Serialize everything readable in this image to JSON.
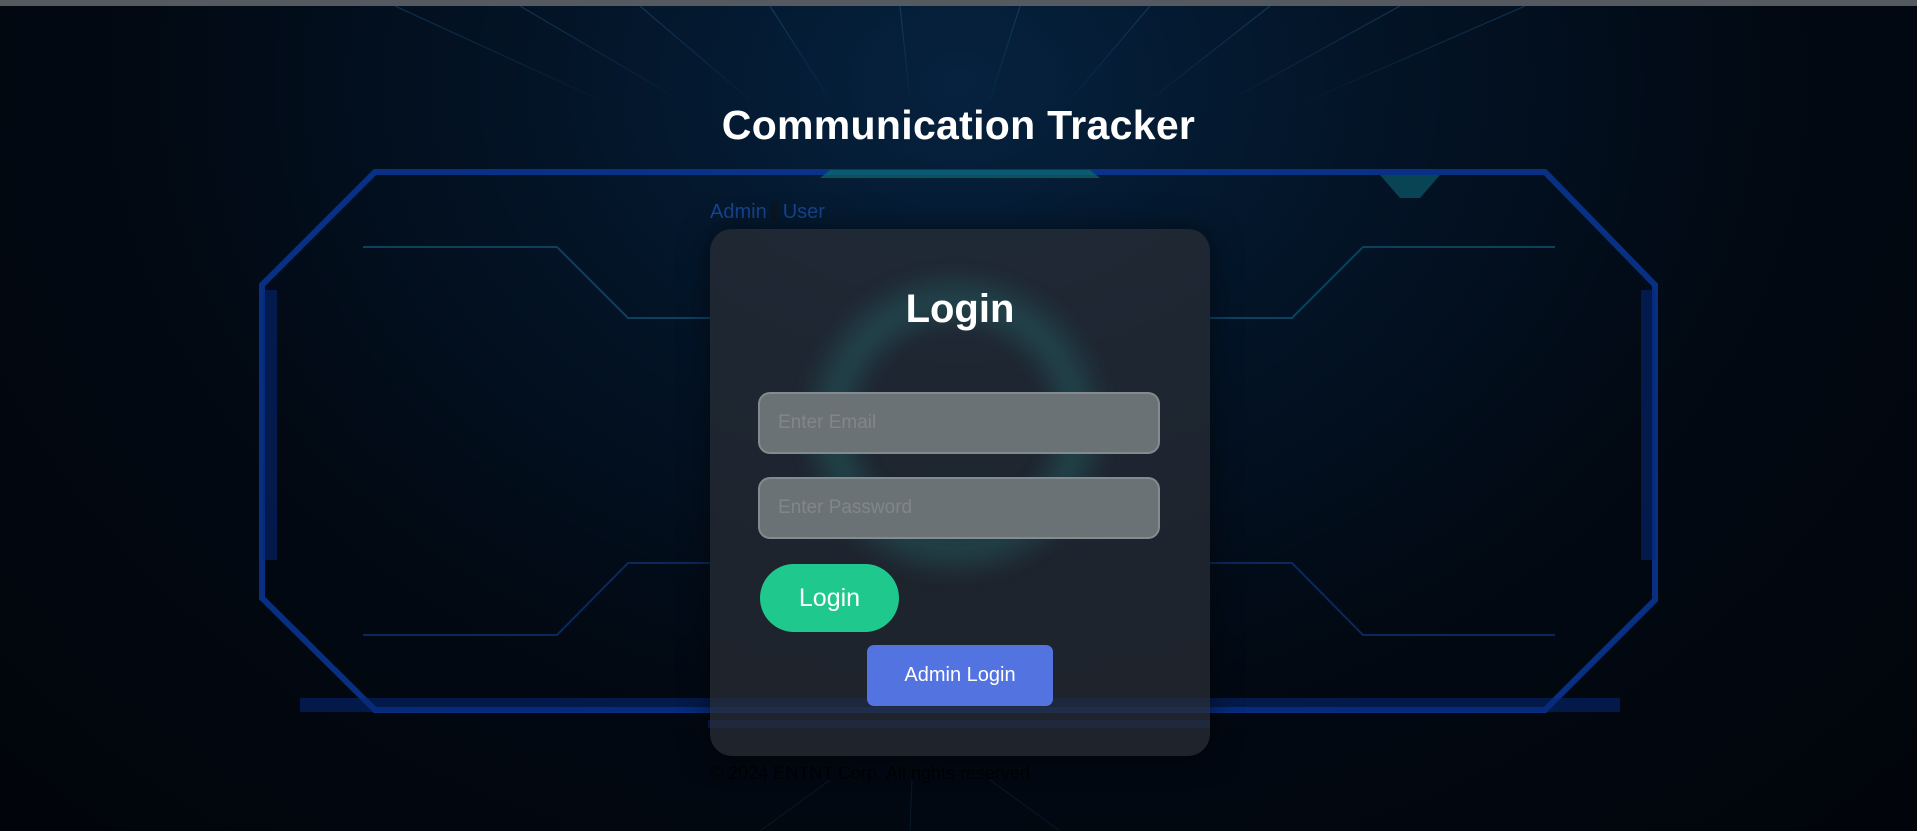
{
  "app": {
    "title": "Communication Tracker"
  },
  "role_tabs": [
    {
      "label": "Admin"
    },
    {
      "label": "User"
    }
  ],
  "login_card": {
    "title": "Login",
    "email_placeholder": "Enter Email",
    "password_placeholder": "Enter Password",
    "login_button": "Login",
    "admin_login_button": "Admin Login"
  },
  "footer": {
    "text": "© 2024 ENTNT Corp. All rights reserved."
  },
  "colors": {
    "background": "#02060d",
    "accent_blue": "#0a3a9e",
    "accent_teal": "#0e5a5a",
    "login_button": "#1fc98e",
    "admin_button": "#5273e0",
    "tab_link": "#17458f"
  }
}
